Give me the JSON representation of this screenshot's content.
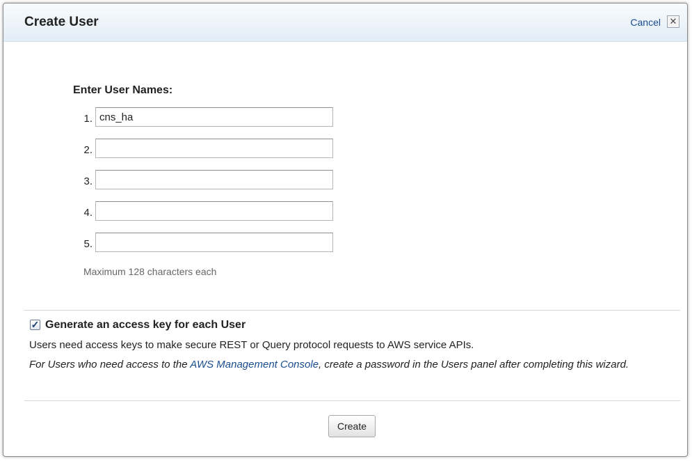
{
  "dialog": {
    "title": "Create User",
    "cancel_label": "Cancel",
    "close_glyph": "✕"
  },
  "names_section": {
    "heading": "Enter User Names:",
    "rows": [
      {
        "number": "1.",
        "value": "cns_ha"
      },
      {
        "number": "2.",
        "value": ""
      },
      {
        "number": "3.",
        "value": ""
      },
      {
        "number": "4.",
        "value": ""
      },
      {
        "number": "5.",
        "value": ""
      }
    ],
    "hint": "Maximum 128 characters each"
  },
  "access_key": {
    "checked": true,
    "check_glyph": "✓",
    "label": "Generate an access key for each User",
    "description": "Users need access keys to make secure REST or Query protocol requests to AWS service APIs.",
    "note_before": "For Users who need access to the ",
    "note_link": "AWS Management Console",
    "note_after": ", create a password in the Users panel after completing this wizard."
  },
  "footer": {
    "create_label": "Create"
  },
  "colors": {
    "header_gradient_top": "#f8fbfd",
    "header_gradient_bottom": "#e3edf6",
    "link": "#1a4d8f",
    "hint_text": "#666666"
  }
}
